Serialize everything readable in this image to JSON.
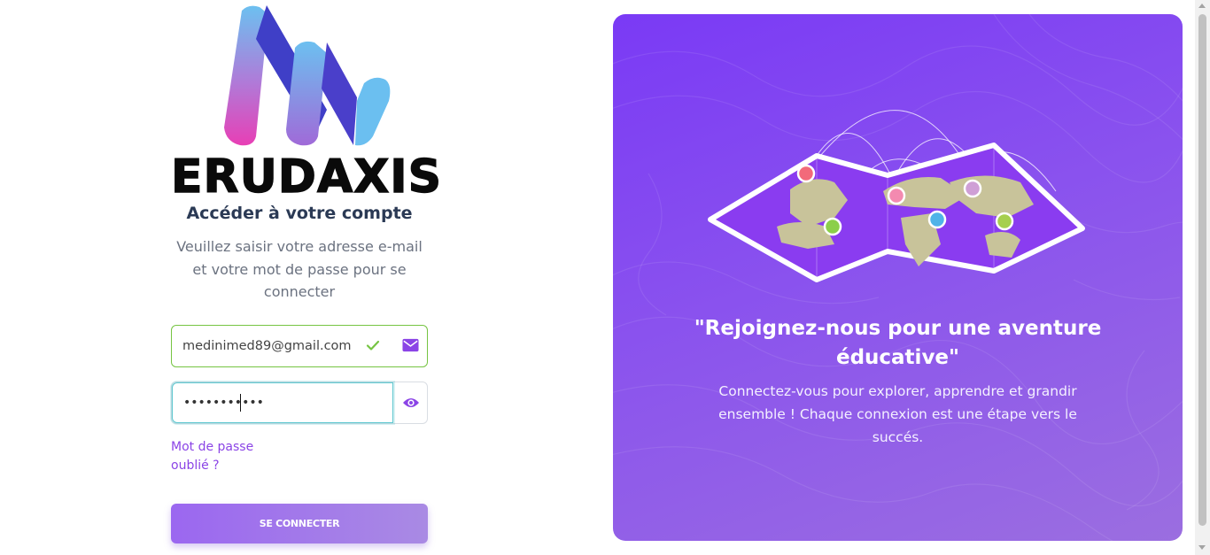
{
  "brand": {
    "name": "ERUDAXIS"
  },
  "login": {
    "title": "Accéder à votre compte",
    "subtitle": "Veuillez saisir votre adresse e-mail et votre mot de passe pour se connecter",
    "email_value": "medinimed89@gmail.com",
    "password_value": "•••••••••••",
    "forgot_link": "Mot de passe oublié ?",
    "submit_label": "SE CONNECTER"
  },
  "promo": {
    "quote": "\"Rejoignez-nous pour une aventure éducative\"",
    "description": "Connectez-vous pour explorer, apprendre et grandir ensemble ! Chaque connexion est une étape vers le succés."
  },
  "icons": {
    "email_valid": "check-icon",
    "email_field": "mail-icon",
    "password_toggle": "eye-icon"
  },
  "colors": {
    "accent": "#8b44e6",
    "valid": "#76c442",
    "focus": "#5fc8d0",
    "panel_start": "#7a3af5",
    "panel_end": "#9b6ee0",
    "heading": "#2b3a55"
  }
}
